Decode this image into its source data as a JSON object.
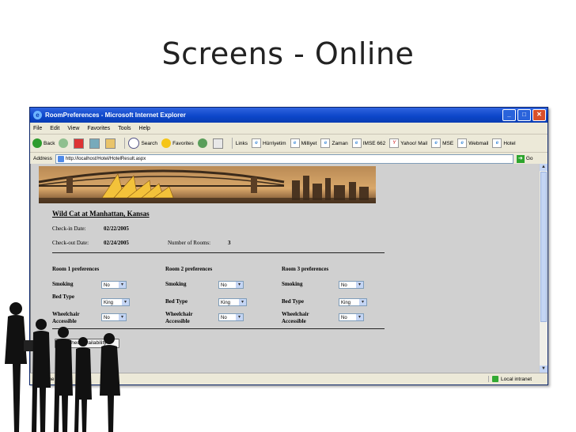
{
  "slide": {
    "title": "Screens - Online"
  },
  "window": {
    "title": "RoomPreferences - Microsoft Internet Explorer",
    "menu": [
      "File",
      "Edit",
      "View",
      "Favorites",
      "Tools",
      "Help"
    ],
    "toolbar": {
      "back": "Back",
      "search": "Search",
      "favorites": "Favorites",
      "links_label": "Links",
      "links": [
        "Hürriyetim",
        "Milliyet",
        "Zaman",
        "IMSE 662",
        "Yahoo! Mail",
        "MSE",
        "Webmail",
        "Hotel"
      ]
    },
    "address": {
      "label": "Address",
      "url": "http://localhost/Hotel/HotelResult.aspx",
      "go": "Go"
    },
    "status": {
      "left": "Done",
      "right": "Local intranet"
    }
  },
  "page": {
    "hotel_title": "Wild Cat at Manhattan, Kansas",
    "checkin_label": "Check-in  Date:",
    "checkin_value": "02/22/2005",
    "checkout_label": "Check-out Date:",
    "checkout_value": "02/24/2005",
    "rooms_label": "Number of Rooms:",
    "rooms_value": "3",
    "rooms": [
      {
        "heading": "Room 1 preferences",
        "smoking_label": "Smoking",
        "smoking": "No",
        "bed_label": "Bed Type",
        "bed": "King",
        "wheel_label_1": "Wheelchair",
        "wheel_label_2": "Accessible",
        "wheel": "No"
      },
      {
        "heading": "Room 2 preferences",
        "smoking_label": "Smoking",
        "smoking": "No",
        "bed_label": "Bed Type",
        "bed": "King",
        "wheel_label_1": "Wheelchair",
        "wheel_label_2": "Accessible",
        "wheel": "No"
      },
      {
        "heading": "Room 3 preferences",
        "smoking_label": "Smoking",
        "smoking": "No",
        "bed_label": "Bed Type",
        "bed": "King",
        "wheel_label_1": "Wheelchair",
        "wheel_label_2": "Accessible",
        "wheel": "No"
      }
    ],
    "check_button": "CheckAvailability"
  }
}
